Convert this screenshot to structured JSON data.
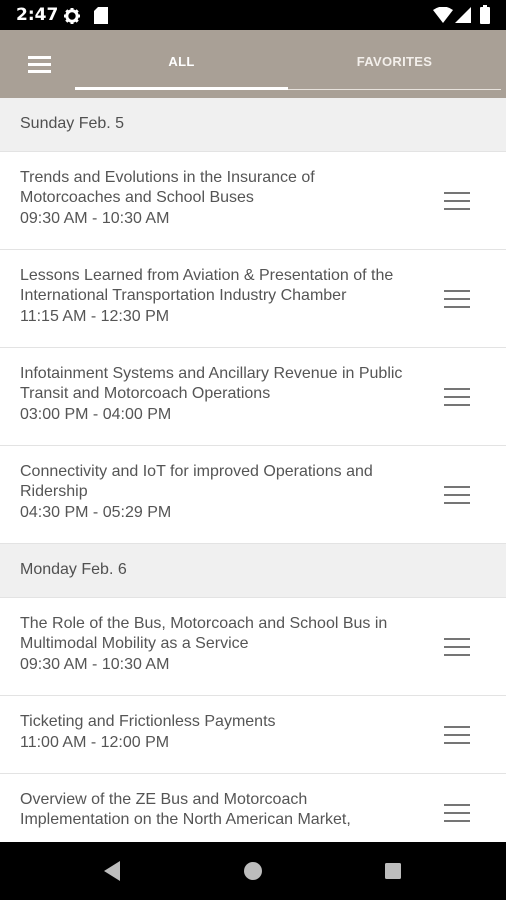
{
  "status_bar": {
    "time": "2:47"
  },
  "app_bar": {
    "tabs": [
      {
        "label": "ALL",
        "selected": true
      },
      {
        "label": "FAVORITES",
        "selected": false
      }
    ]
  },
  "schedule": [
    {
      "day": "Sunday Feb. 5",
      "sessions": [
        {
          "title": "Trends and Evolutions in the Insurance of Motorcoaches and School Buses",
          "time": "09:30 AM - 10:30 AM"
        },
        {
          "title": "Lessons Learned from Aviation & Presentation of the International Transportation Industry Chamber",
          "time": "11:15 AM - 12:30 PM"
        },
        {
          "title": "Infotainment Systems and Ancillary Revenue in Public Transit and Motorcoach Operations",
          "time": "03:00 PM - 04:00 PM"
        },
        {
          "title": "Connectivity and IoT for improved Operations and Ridership",
          "time": "04:30 PM - 05:29 PM"
        }
      ]
    },
    {
      "day": "Monday Feb. 6",
      "sessions": [
        {
          "title": "The Role of the Bus, Motorcoach and School Bus in Multimodal Mobility as a Service",
          "time": "09:30 AM - 10:30 AM"
        },
        {
          "title": "Ticketing and Frictionless Payments",
          "time": "11:00 AM - 12:00 PM"
        },
        {
          "title": "Overview of the ZE Bus and Motorcoach Implementation on the North American Market,",
          "time": ""
        }
      ]
    }
  ],
  "colors": {
    "app_bar": "#a9a096",
    "status_bar": "#000000",
    "day_header_bg": "#f0f0f0",
    "text": "#555555"
  }
}
